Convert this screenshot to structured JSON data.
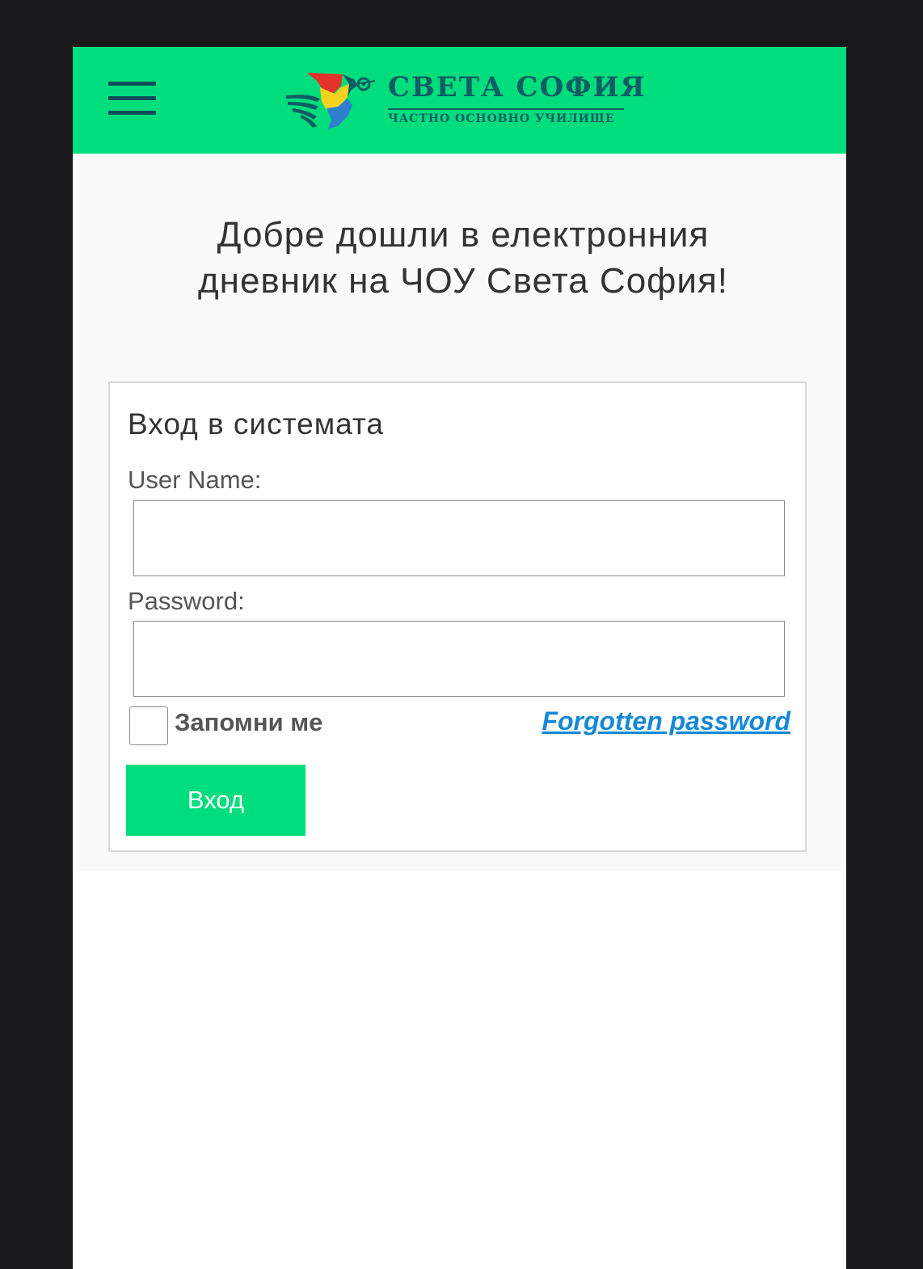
{
  "header": {
    "logo_title": "СВЕТА СОФИЯ",
    "logo_subtitle": "ЧАСТНО ОСНОВНО УЧИЛИЩЕ",
    "brand_color": "#00dd7c",
    "icon_menu": "hamburger-menu-icon"
  },
  "main": {
    "welcome_text": "Добре дошли в електронния дневник на ЧОУ Света София!"
  },
  "login": {
    "title": "Вход в системата",
    "username_label": "User Name:",
    "username_value": "",
    "password_label": "Password:",
    "password_value": "",
    "remember_label": "Запомни ме",
    "remember_checked": false,
    "forgot_link": "Forgotten password",
    "submit_label": "Вход",
    "link_color": "#1588d6"
  }
}
